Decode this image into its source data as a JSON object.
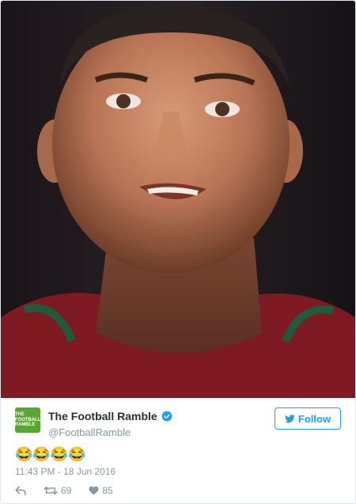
{
  "tweet": {
    "display_name": "The Football Ramble",
    "handle": "@FootballRamble",
    "avatar_text": "THE FOOTBALL RAMBLE",
    "follow_label": "Follow",
    "text": "😂😂😂😂",
    "timestamp": "11:43 PM - 18 Jun 2016",
    "retweet_count": "69",
    "like_count": "85"
  },
  "colors": {
    "avatar_bg": "#5aa632",
    "accent": "#1da1f2",
    "muted": "#8899a6",
    "text": "#292f33"
  },
  "icons": [
    "verified-icon",
    "twitter-bird-icon",
    "reply-icon",
    "retweet-icon",
    "heart-icon"
  ]
}
